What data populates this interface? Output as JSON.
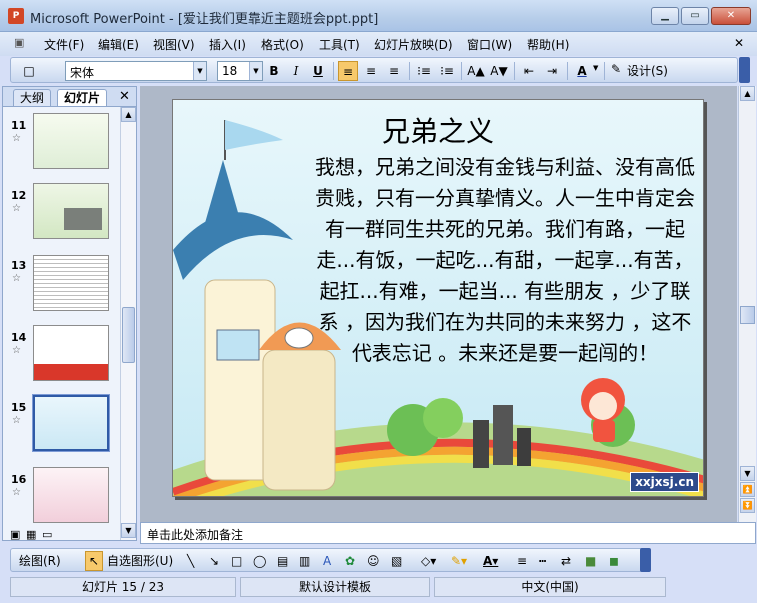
{
  "window": {
    "title": "Microsoft PowerPoint - [爱让我们更靠近主题班会ppt.ppt]",
    "app_icon": "P"
  },
  "menubar": [
    "文件(F)",
    "编辑(E)",
    "视图(V)",
    "插入(I)",
    "格式(O)",
    "工具(T)",
    "幻灯片放映(D)",
    "窗口(W)",
    "帮助(H)"
  ],
  "toolbar": {
    "font": "宋体",
    "size": "18",
    "bold": "B",
    "italic": "I",
    "underline": "U",
    "design_label": "设计(S)"
  },
  "left_pane": {
    "tabs": [
      "大纲",
      "幻灯片"
    ],
    "thumbs": [
      {
        "num": "11",
        "star": "☆"
      },
      {
        "num": "12",
        "star": "☆"
      },
      {
        "num": "13",
        "star": "☆"
      },
      {
        "num": "14",
        "star": "☆"
      },
      {
        "num": "15",
        "star": "☆"
      },
      {
        "num": "16",
        "star": "☆"
      }
    ],
    "selected_index": 4
  },
  "slide": {
    "title": "兄弟之义",
    "body": "我想，兄弟之间没有金钱与利益、没有高低贵贱，只有一分真挚情义。人一生中肯定会有一群同生共死的兄弟。我们有路，一起走...有饭，一起吃...有甜，一起享...有苦，起扛...有难，一起当... 有些朋友 ，少了联系 ，因为我们在为共同的未来努力 ，这不代表忘记 。未来还是要一起闯的！",
    "watermark": "xxjxsj.cn"
  },
  "notes": {
    "placeholder": "单击此处添加备注"
  },
  "drawbar": {
    "draw": "绘图(R)",
    "autoshapes": "自选图形(U)"
  },
  "status": {
    "slide": "幻灯片 15 / 23",
    "template": "默认设计模板",
    "language": "中文(中国)"
  }
}
